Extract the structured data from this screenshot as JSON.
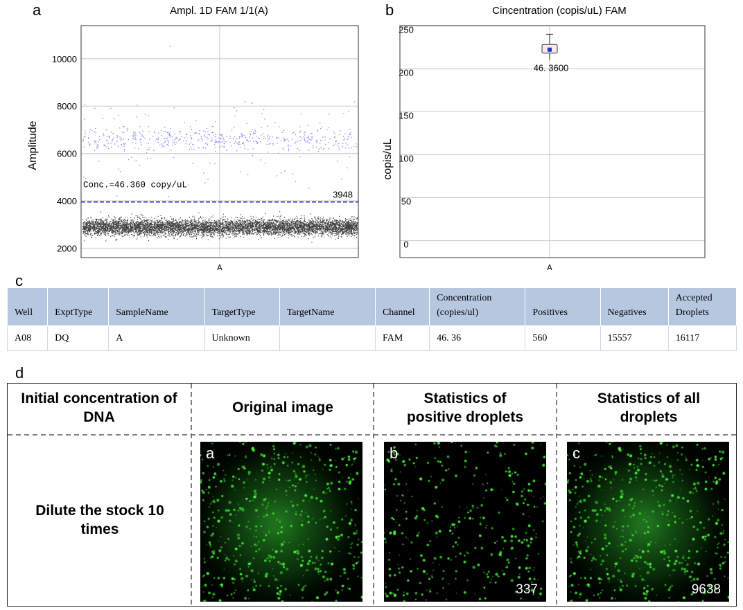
{
  "panel_labels": {
    "a": "a",
    "b": "b",
    "c": "c",
    "d": "d"
  },
  "chart_data": [
    {
      "type": "scatter",
      "title": "Ampl. 1D FAM 1/1(A)",
      "ylabel": "Amplitude",
      "xlabel": "",
      "x_categories": [
        "A"
      ],
      "ylim": [
        1600,
        11400
      ],
      "yticks": [
        2000,
        4000,
        6000,
        8000,
        10000
      ],
      "grid": true,
      "threshold": {
        "value": 3948,
        "label": "3948",
        "color": "#1e2bd6"
      },
      "annotation": "Conc.=46.360 copy/uL",
      "series": [
        {
          "name": "negatives",
          "color": "#000000",
          "count": 15557,
          "center": 2900,
          "range": [
            2100,
            3600
          ]
        },
        {
          "name": "positives",
          "color": "#8a8ff0",
          "count": 560,
          "center": 6600,
          "range": [
            4200,
            8200
          ]
        }
      ],
      "outliers": [
        10550,
        8200,
        8150
      ]
    },
    {
      "type": "box",
      "title": "Cincentration (copis/uL) FAM",
      "ylabel": "copis/uL",
      "xlabel": "",
      "x_categories": [
        "A"
      ],
      "ylim": [
        -10,
        260
      ],
      "yticks": [
        0,
        50,
        100,
        150,
        200,
        250
      ],
      "grid": true,
      "box": {
        "median": 232,
        "q1": 228,
        "q3": 238,
        "whisker_low": 220,
        "whisker_high": 250
      },
      "box_label": "46. 3600"
    }
  ],
  "table": {
    "headers": [
      "Well",
      "ExptType",
      "SampleName",
      "TargetType",
      "TargetName",
      "Channel",
      "Concentration (copies/ul)",
      "Positives",
      "Negatives",
      "Accepted Droplets"
    ],
    "rows": [
      [
        "A08",
        "DQ",
        "A",
        "Unknown",
        "",
        "FAM",
        "46. 36",
        "560",
        "15557",
        "16117"
      ]
    ]
  },
  "panel_d": {
    "headers": [
      "Initial concentration of DNA",
      "Original image",
      "Statistics of positive droplets",
      "Statistics of all droplets"
    ],
    "row_label": "Dilute the stock 10 times",
    "images": [
      {
        "label": "a",
        "count": ""
      },
      {
        "label": "b",
        "count": "337"
      },
      {
        "label": "c",
        "count": "9638"
      }
    ]
  }
}
